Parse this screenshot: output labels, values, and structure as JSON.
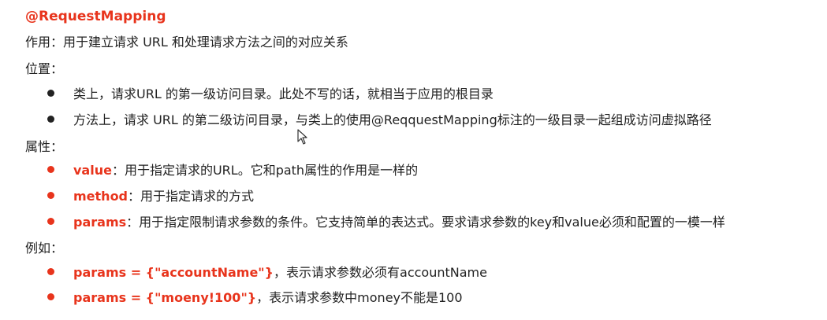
{
  "title": "@RequestMapping",
  "purpose": "作用：用于建立请求 URL 和处理请求方法之间的对应关系",
  "location_heading": "位置：",
  "location_items": [
    "类上，请求URL 的第一级访问目录。此处不写的话，就相当于应用的根目录",
    "方法上，请求 URL 的第二级访问目录，与类上的使用@ReqquestMapping标注的一级目录一起组成访问虚拟路径"
  ],
  "attributes_heading": "属性：",
  "attributes": [
    {
      "key": "value",
      "desc": "：用于指定请求的URL。它和path属性的作用是一样的"
    },
    {
      "key": "method",
      "desc": "：用于指定请求的方式"
    },
    {
      "key": "params",
      "desc": "：用于指定限制请求参数的条件。它支持简单的表达式。要求请求参数的key和value必须和配置的一模一样"
    }
  ],
  "examples_heading": "例如：",
  "examples": [
    {
      "key": "params = {\"accountName\"}",
      "desc": "，表示请求参数必须有accountName"
    },
    {
      "key": "params = {\"moeny!100\"}",
      "desc": "，表示请求参数中money不能是100"
    }
  ],
  "colors": {
    "accent": "#e8341c",
    "text": "#222222"
  },
  "icons": {
    "cursor": "mouse-pointer-icon"
  }
}
